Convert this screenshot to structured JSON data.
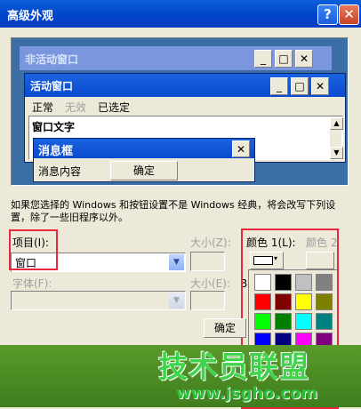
{
  "dialog": {
    "title": "高级外观",
    "help_glyph": "?",
    "close_glyph": "✕"
  },
  "preview": {
    "inactive_window_title": "非活动窗口",
    "active_window_title": "活动窗口",
    "menu": {
      "normal": "正常",
      "disabled": "无效",
      "selected": "已选定"
    },
    "window_text": "窗口文字",
    "message_box": {
      "title": "消息框",
      "content": "消息内容",
      "ok_label": "确定"
    },
    "window_buttons": {
      "minimize": "_",
      "maximize": "□",
      "close": "✕"
    }
  },
  "description": "如果您选择的 Windows 和按钮设置不是 Windows 经典，将会改写下列设置，除了一些旧程序以外。",
  "item": {
    "label": "项目(I):",
    "value": "窗口"
  },
  "size": {
    "label": "大小(Z):"
  },
  "font": {
    "label": "字体(F):"
  },
  "font_size": {
    "label": "大小(E):"
  },
  "color1": {
    "label": "颜色 1(L):",
    "caret": "▾"
  },
  "color2": {
    "label": "颜色 2"
  },
  "b_label": "B",
  "palette": {
    "colors": [
      "#ffffff",
      "#000000",
      "#c0c0c0",
      "#808080",
      "#ff0000",
      "#800000",
      "#ffff00",
      "#808000",
      "#00ff00",
      "#008000",
      "#00ffff",
      "#008080",
      "#0000ff",
      "#000080",
      "#ff00ff",
      "#800080",
      "#d4d0c8",
      "#d4d0c8",
      "#d4d0c8",
      "#c0c0c0",
      "#d4d0c8",
      "#d4d0c8",
      "#d4d0c8",
      "#d4d0c8"
    ]
  },
  "ok_button": {
    "label": "确定"
  },
  "watermark": {
    "main": "技术员联盟",
    "url": "www.jsgho.com"
  },
  "colors": {
    "title_blue": "#0042c8",
    "highlight_red": "#e8283c",
    "preview_bg": "#3a6ea5"
  }
}
